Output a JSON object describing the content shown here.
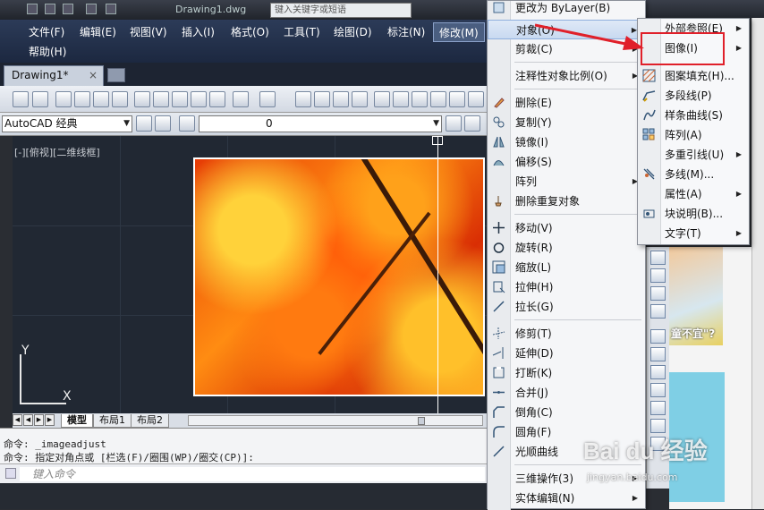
{
  "titlebar": {
    "title": "Drawing1.dwg",
    "search_placeholder": "键入关键字或短语"
  },
  "menubar": {
    "items": [
      {
        "label": "文件(F)"
      },
      {
        "label": "编辑(E)"
      },
      {
        "label": "视图(V)"
      },
      {
        "label": "插入(I)"
      },
      {
        "label": "格式(O)"
      },
      {
        "label": "工具(T)"
      },
      {
        "label": "绘图(D)"
      },
      {
        "label": "标注(N)"
      },
      {
        "label": "修改(M)"
      },
      {
        "label": "帮助(H)"
      }
    ]
  },
  "tabs": {
    "drawing": "Drawing1*",
    "close": "×"
  },
  "toolbar2": {
    "workspace": "AutoCAD 经典",
    "layer": "0"
  },
  "canvas": {
    "view_label": "[-][俯视][二维线框]",
    "ucs_x": "X",
    "ucs_y": "Y"
  },
  "layout_tabs": [
    "模型",
    "布局1",
    "布局2"
  ],
  "command": {
    "history": [
      "命令: _imageadjust",
      "命令: 指定对角点或 [栏选(F)/圈围(WP)/圈交(CP)]:"
    ],
    "input_placeholder": "键入命令"
  },
  "modify_menu": {
    "items": [
      {
        "label": "更改为 ByLayer(B)",
        "icon": "bylayer-icon",
        "submenu": false
      },
      {
        "label": "对象(O)",
        "icon": "",
        "submenu": true,
        "highlight": true
      },
      {
        "label": "剪裁(C)",
        "icon": "",
        "submenu": true
      },
      {
        "label": "注释性对象比例(O)",
        "icon": "",
        "submenu": true
      },
      {
        "label": "删除(E)",
        "icon": "eraser-icon",
        "submenu": false
      },
      {
        "label": "复制(Y)",
        "icon": "copy-icon",
        "submenu": false
      },
      {
        "label": "镜像(I)",
        "icon": "mirror-icon",
        "submenu": false
      },
      {
        "label": "偏移(S)",
        "icon": "offset-icon",
        "submenu": false
      },
      {
        "label": "阵列",
        "icon": "",
        "submenu": true
      },
      {
        "label": "删除重复对象",
        "icon": "delete-duplicates-icon",
        "submenu": false
      },
      {
        "label": "移动(V)",
        "icon": "move-icon",
        "submenu": false
      },
      {
        "label": "旋转(R)",
        "icon": "rotate-icon",
        "submenu": false
      },
      {
        "label": "缩放(L)",
        "icon": "scale-icon",
        "submenu": false
      },
      {
        "label": "拉伸(H)",
        "icon": "stretch-icon",
        "submenu": false
      },
      {
        "label": "拉长(G)",
        "icon": "lengthen-icon",
        "submenu": false
      },
      {
        "label": "修剪(T)",
        "icon": "trim-icon",
        "submenu": false
      },
      {
        "label": "延伸(D)",
        "icon": "extend-icon",
        "submenu": false
      },
      {
        "label": "打断(K)",
        "icon": "break-icon",
        "submenu": false
      },
      {
        "label": "合并(J)",
        "icon": "join-icon",
        "submenu": false
      },
      {
        "label": "倒角(C)",
        "icon": "chamfer-icon",
        "submenu": false
      },
      {
        "label": "圆角(F)",
        "icon": "fillet-icon",
        "submenu": false
      },
      {
        "label": "光顺曲线",
        "icon": "blend-icon",
        "submenu": false
      },
      {
        "label": "三维操作(3)",
        "icon": "",
        "submenu": true
      },
      {
        "label": "实体编辑(N)",
        "icon": "",
        "submenu": true
      }
    ]
  },
  "object_submenu": {
    "items": [
      {
        "label": "外部参照(E)",
        "submenu": true
      },
      {
        "label": "图像(I)",
        "submenu": true
      },
      {
        "label": "图案填充(H)...",
        "icon": "hatch-icon"
      },
      {
        "label": "多段线(P)",
        "icon": "polyline-icon"
      },
      {
        "label": "样条曲线(S)",
        "icon": "spline-icon"
      },
      {
        "label": "阵列(A)",
        "icon": "array-icon"
      },
      {
        "label": "多重引线(U)",
        "submenu": true
      },
      {
        "label": "多线(M)...",
        "icon": "multiline-icon"
      },
      {
        "label": "属性(A)",
        "submenu": true
      },
      {
        "label": "块说明(B)...",
        "icon": "block-desc-icon"
      },
      {
        "label": "文字(T)",
        "submenu": true
      }
    ]
  },
  "right_panel": {
    "text": "童不宜\"?"
  },
  "watermark": {
    "text": "Bai du 经验",
    "sub": "jingyan.baidu.com"
  },
  "colors": {
    "callout": "#e0202a",
    "menu_highlight": "#c8d9f0",
    "menubar": "#1c2840"
  }
}
